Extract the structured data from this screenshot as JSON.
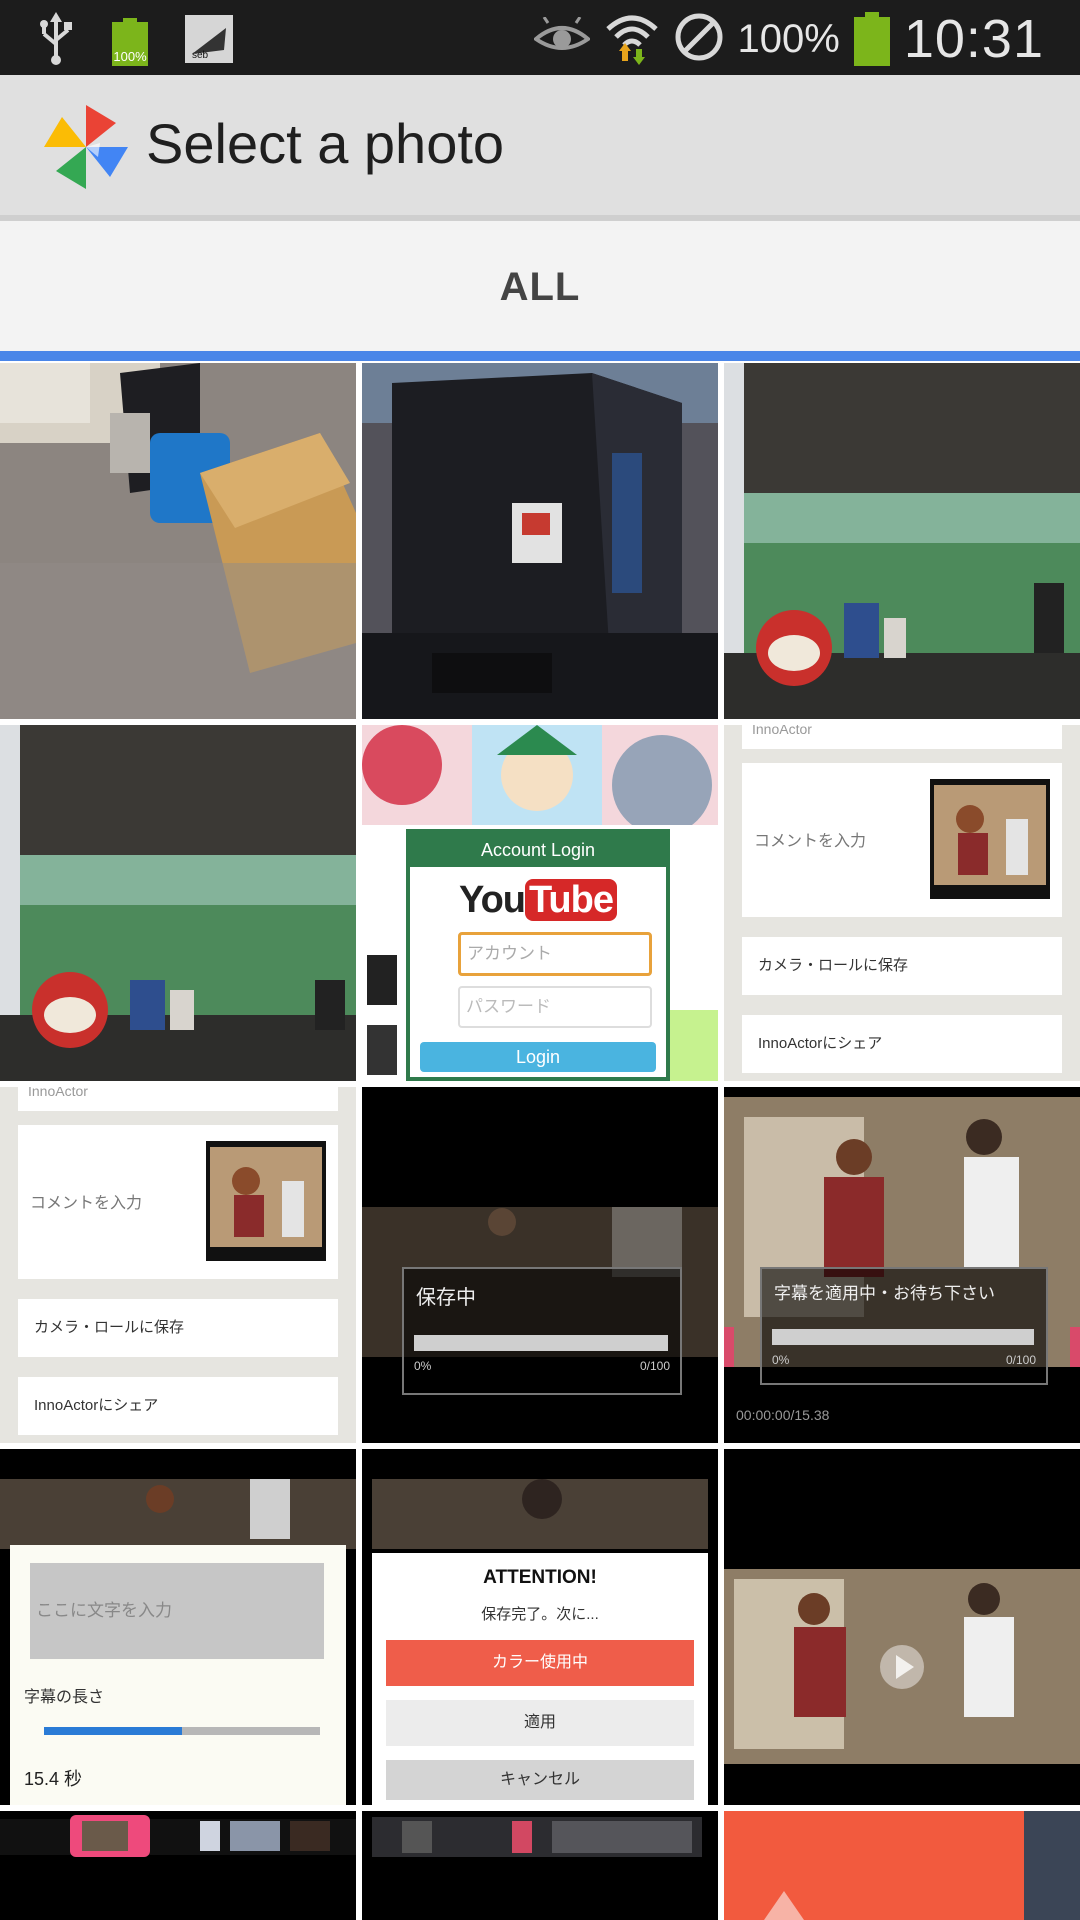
{
  "status_bar": {
    "icons": [
      "usb-icon",
      "battery-100-icon",
      "app-notification-icon",
      "eye-icon",
      "wifi-icon",
      "no-sim-icon",
      "battery-icon"
    ],
    "small_battery_label": "100%",
    "battery_percent": "100%",
    "time": "10:31",
    "colors": {
      "background": "#1c1c1c",
      "battery": "#7cb51b"
    }
  },
  "action_bar": {
    "title": "Select a photo",
    "logo_icon": "photos-pinwheel-icon"
  },
  "tabs": [
    {
      "label": "ALL",
      "selected": true
    }
  ],
  "accent_color": "#4a86e8",
  "tiles": {
    "login": {
      "title": "Account Login",
      "logo_left": "You",
      "logo_right": "Tube",
      "username_placeholder": "アカウント",
      "password_placeholder": "パスワード",
      "button": "Login"
    },
    "share_menu": {
      "header": "InnoActor",
      "comment": "コメントを入力",
      "camera_roll": "カメラ・ロールに保存",
      "share": "InnoActorにシェア"
    },
    "saving": {
      "label": "保存中",
      "progress_start": "0%",
      "progress_end": "0/100"
    },
    "subtitle_saving": {
      "label": "字幕を適用中・お待ち下さい",
      "progress_start": "0%",
      "progress_end": "0/100",
      "timecode": "00:00:00/15.38"
    },
    "text_entry": {
      "placeholder": "ここに文字を入力",
      "size_label": "字幕の長さ",
      "duration": "15.4 秒",
      "slider_value": 0.5
    },
    "attention": {
      "title": "ATTENTION!",
      "message": "保存完了。次に...",
      "primary": "カラー使用中",
      "secondary": "適用",
      "cancel": "キャンセル"
    }
  }
}
